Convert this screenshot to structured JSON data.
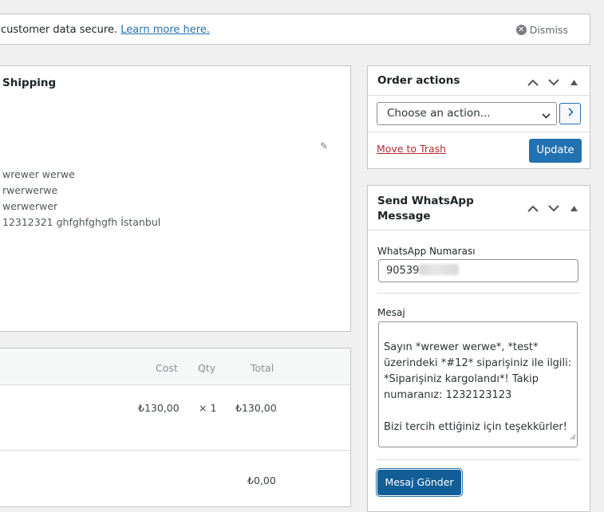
{
  "notice": {
    "text": "customer data secure.",
    "link": "Learn more here.",
    "dismiss": "Dismiss"
  },
  "shipping": {
    "title": "Shipping",
    "lines": [
      "wrewer werwe",
      "rwerwerwe",
      "werwerwer",
      "12312321 ghfghfghgfh İstanbul"
    ]
  },
  "items": {
    "headers": {
      "cost": "Cost",
      "qty": "Qty",
      "total": "Total"
    },
    "row": {
      "cost": "₺130,00",
      "qty": "× 1",
      "total": "₺130,00"
    },
    "summary_value": "₺0,00"
  },
  "order_actions": {
    "title": "Order actions",
    "select_value": "Choose an action...",
    "trash": "Move to Trash",
    "update": "Update"
  },
  "whatsapp": {
    "title": "Send WhatsApp Message",
    "phone_label": "WhatsApp Numarası",
    "phone_value": "90539",
    "message_label": "Mesaj",
    "message": "Sayın *wrewer werwe*, *test* üzerindeki *#12* siparişiniz ile ilgili: *Siparişiniz kargolandı*! Takip numaranız: 1232123123\n\nBizi tercih ettiğiniz için teşekkürler!",
    "send": "Mesaj Gönder"
  },
  "icons": {
    "dismiss": "close-circle-icon",
    "edit": "pencil-icon",
    "up": "chevron-up-icon",
    "down": "chevron-down-icon",
    "toggle": "triangle-up-icon",
    "go": "chevron-right-icon",
    "resize": "resize-grip-icon"
  },
  "colors": {
    "primary": "#2271b1",
    "primary_dark": "#135e96",
    "danger": "#b32d2e",
    "border": "#c3c4c7",
    "background": "#f0f0f1"
  }
}
